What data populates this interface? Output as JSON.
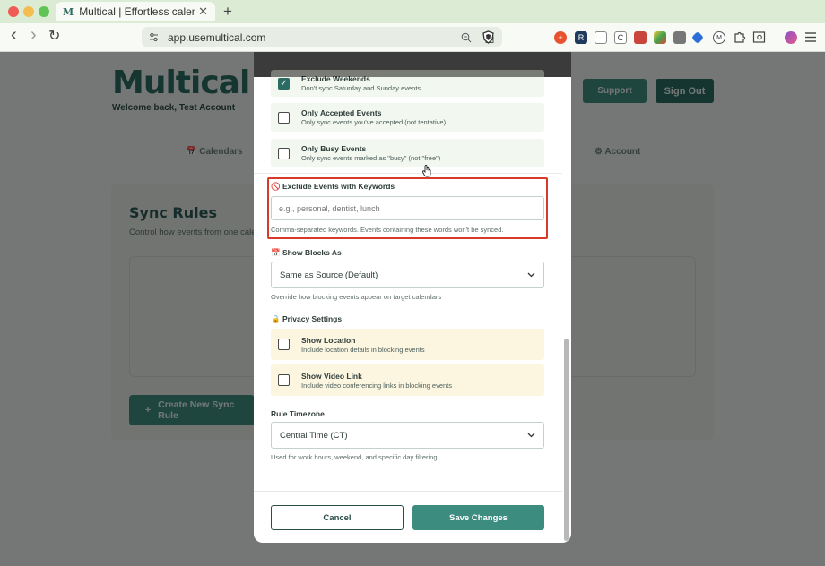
{
  "browser": {
    "tab_title": "Multical | Effortless calendar s",
    "tab_favicon": "M",
    "tab_close": "✕",
    "new_tab": "+",
    "url": "app.usemultical.com",
    "back": "‹",
    "forward": "›",
    "reload": "↻"
  },
  "header": {
    "logo": "Multical",
    "welcome": "Welcome back, Test Account",
    "support_label": "Support",
    "signout_label": "Sign Out"
  },
  "nav": {
    "calendars": "📅 Calendars",
    "account": "⚙ Account"
  },
  "sync_rules": {
    "title": "Sync Rules",
    "subtitle": "Control how events from one cale",
    "create_label": "Create New Sync Rule",
    "create_icon": "+"
  },
  "modal": {
    "options": [
      {
        "label": "Exclude Weekends",
        "desc": "Don't sync Saturday and Sunday events",
        "checked": true
      },
      {
        "label": "Only Accepted Events",
        "desc": "Only sync events you've accepted (not tentative)",
        "checked": false
      },
      {
        "label": "Only Busy Events",
        "desc": "Only sync events marked as \"busy\" (not \"free\")",
        "checked": false
      }
    ],
    "keywords": {
      "label": "🚫 Exclude Events with Keywords",
      "placeholder": "e.g., personal, dentist, lunch",
      "help": "Comma-separated keywords. Events containing these words won't be synced."
    },
    "show_blocks": {
      "label": "📅 Show Blocks As",
      "value": "Same as Source (Default)",
      "help": "Override how blocking events appear on target calendars"
    },
    "privacy": {
      "label": "🔒 Privacy Settings",
      "options": [
        {
          "label": "Show Location",
          "desc": "Include location details in blocking events",
          "checked": false
        },
        {
          "label": "Show Video Link",
          "desc": "Include video conferencing links in blocking events",
          "checked": false
        }
      ]
    },
    "timezone": {
      "label": "Rule Timezone",
      "value": "Central Time (CT)",
      "help": "Used for work hours, weekend, and specific day filtering"
    },
    "cancel_label": "Cancel",
    "save_label": "Save Changes"
  },
  "colors": {
    "brand": "#2b6b63",
    "accent": "#3c8c7f",
    "highlight": "#d63a2a"
  }
}
